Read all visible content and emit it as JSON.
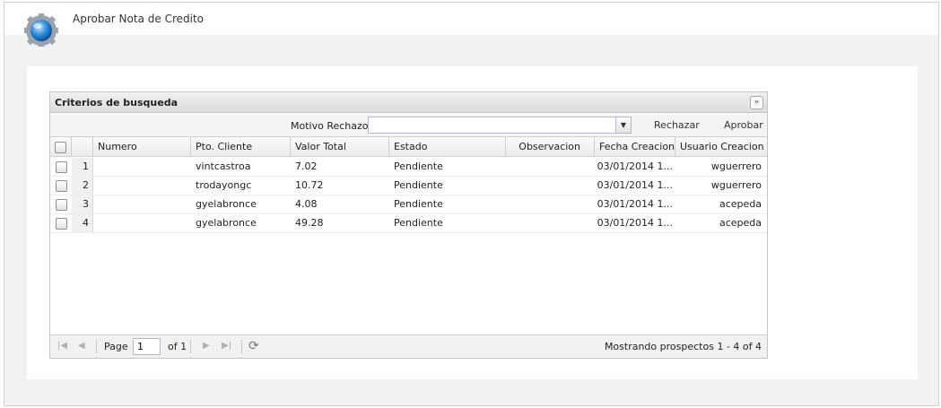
{
  "header": {
    "title": "Aprobar Nota de Credito"
  },
  "panel": {
    "title": "Criterios de busqueda",
    "collapse_glyph": "»"
  },
  "toolbar": {
    "reason_label": "Motivo Rechazo:",
    "reason_value": "",
    "reject_label": "Rechazar",
    "approve_label": "Aprobar"
  },
  "grid": {
    "columns": [
      "Numero",
      "Pto. Cliente",
      "Valor Total",
      "Estado",
      "Observacion",
      "Fecha Creacion",
      "Usuario Creacion"
    ],
    "rows": [
      {
        "n": "1",
        "numero": "",
        "pto_cliente": "vintcastroa",
        "valor_total": "7.02",
        "estado": "Pendiente",
        "observacion": "",
        "fecha_creacion": "03/01/2014 1...",
        "usuario_creacion": "wguerrero"
      },
      {
        "n": "2",
        "numero": "",
        "pto_cliente": "trodayongc",
        "valor_total": "10.72",
        "estado": "Pendiente",
        "observacion": "",
        "fecha_creacion": "03/01/2014 1...",
        "usuario_creacion": "wguerrero"
      },
      {
        "n": "3",
        "numero": "",
        "pto_cliente": "gyelabronce",
        "valor_total": "4.08",
        "estado": "Pendiente",
        "observacion": "",
        "fecha_creacion": "03/01/2014 1...",
        "usuario_creacion": "acepeda"
      },
      {
        "n": "4",
        "numero": "",
        "pto_cliente": "gyelabronce",
        "valor_total": "49.28",
        "estado": "Pendiente",
        "observacion": "",
        "fecha_creacion": "03/01/2014 1...",
        "usuario_creacion": "acepeda"
      }
    ]
  },
  "pager": {
    "page_label": "Page",
    "page_value": "1",
    "of_label": "of 1",
    "status": "Mostrando prospectos 1 - 4 of 4"
  },
  "icons": {
    "logo": "globe-gear-icon",
    "first": "first-page-icon",
    "prev": "prev-page-icon",
    "next": "next-page-icon",
    "last": "last-page-icon",
    "refresh": "refresh-icon",
    "combo": "chevron-down-icon"
  }
}
